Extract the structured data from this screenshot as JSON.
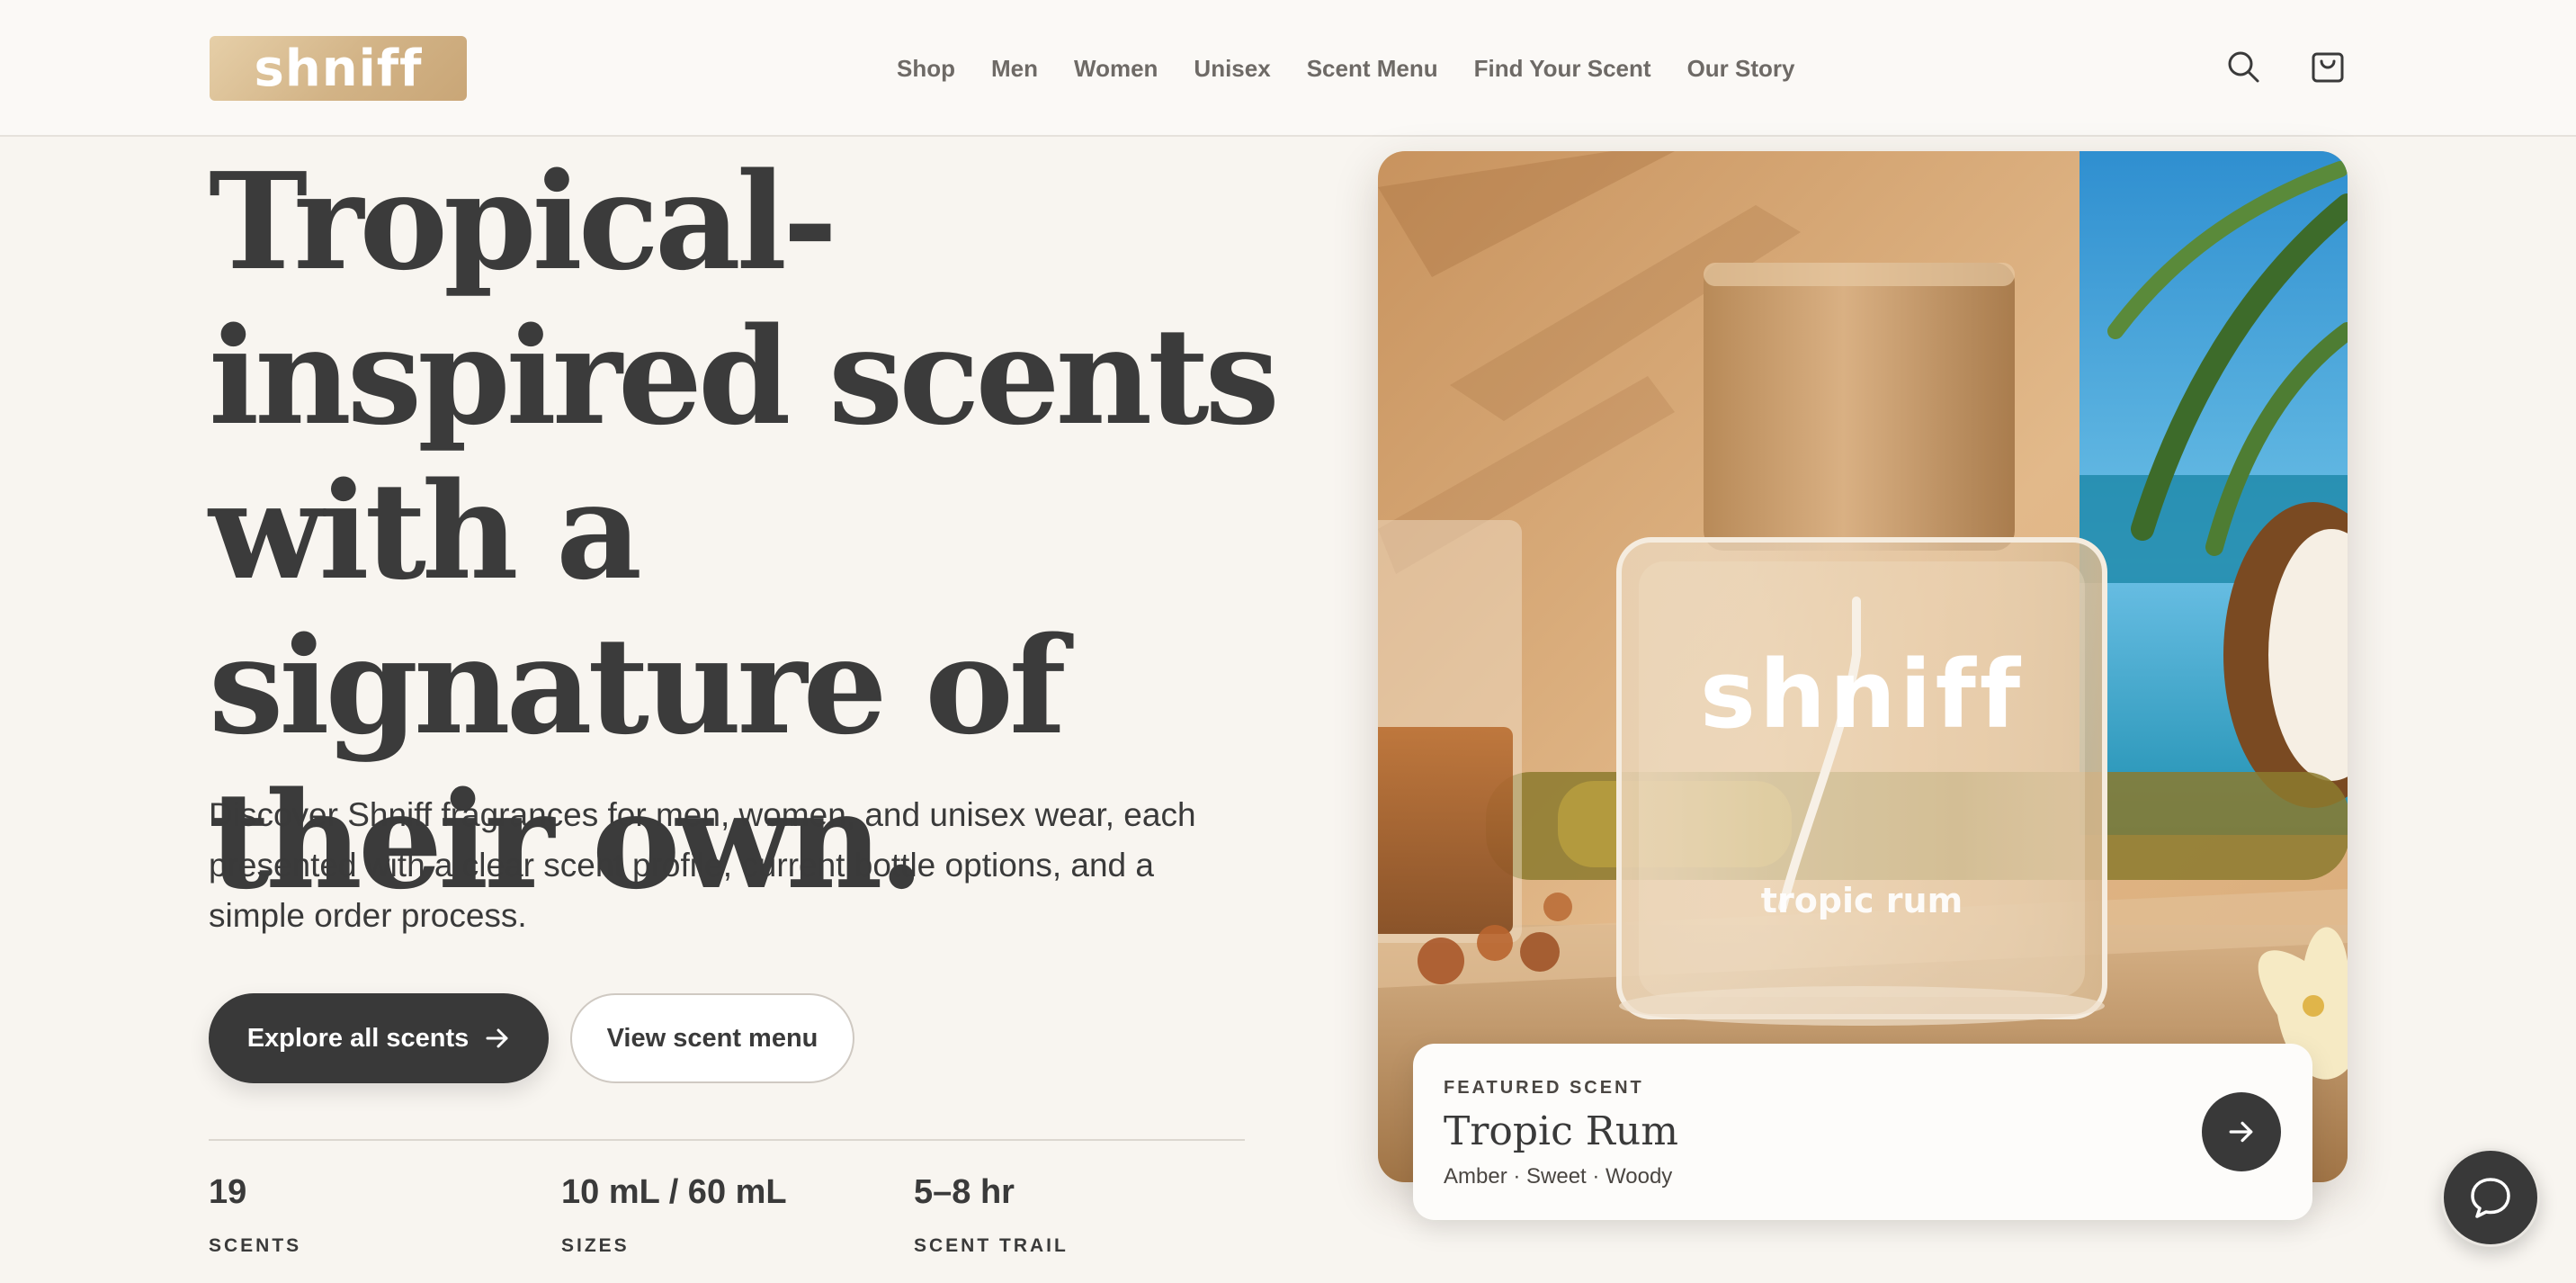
{
  "brand": {
    "logo_text": "shniff"
  },
  "nav": {
    "items": [
      "Shop",
      "Men",
      "Women",
      "Unisex",
      "Scent Menu",
      "Find Your Scent",
      "Our Story"
    ]
  },
  "header_icons": {
    "search": "search-icon",
    "cart": "shopping-bag-icon"
  },
  "hero": {
    "title": "Tropical-inspired scents with a signature of their own.",
    "description": "Discover Shniff fragrances for men, women, and unisex wear, each presented with a clear scent profile, current bottle options, and a simple order process.",
    "primary_cta": "Explore all scents",
    "secondary_cta": "View scent menu"
  },
  "stats": [
    {
      "value": "19",
      "label": "SCENTS"
    },
    {
      "value": "10 mL / 60 mL",
      "label": "SIZES"
    },
    {
      "value": "5–8 hr",
      "label": "SCENT TRAIL"
    }
  ],
  "product_image": {
    "bottle_brand": "shniff",
    "bottle_name": "tropic rum"
  },
  "featured": {
    "eyebrow": "FEATURED SCENT",
    "name": "Tropic Rum",
    "notes": "Amber · Sweet · Woody"
  },
  "colors": {
    "dark": "#393939",
    "background": "#f8f5f0",
    "logo_gold": "#d2b386",
    "wood": "#c79c6a",
    "sea": "#1f8fb8"
  }
}
